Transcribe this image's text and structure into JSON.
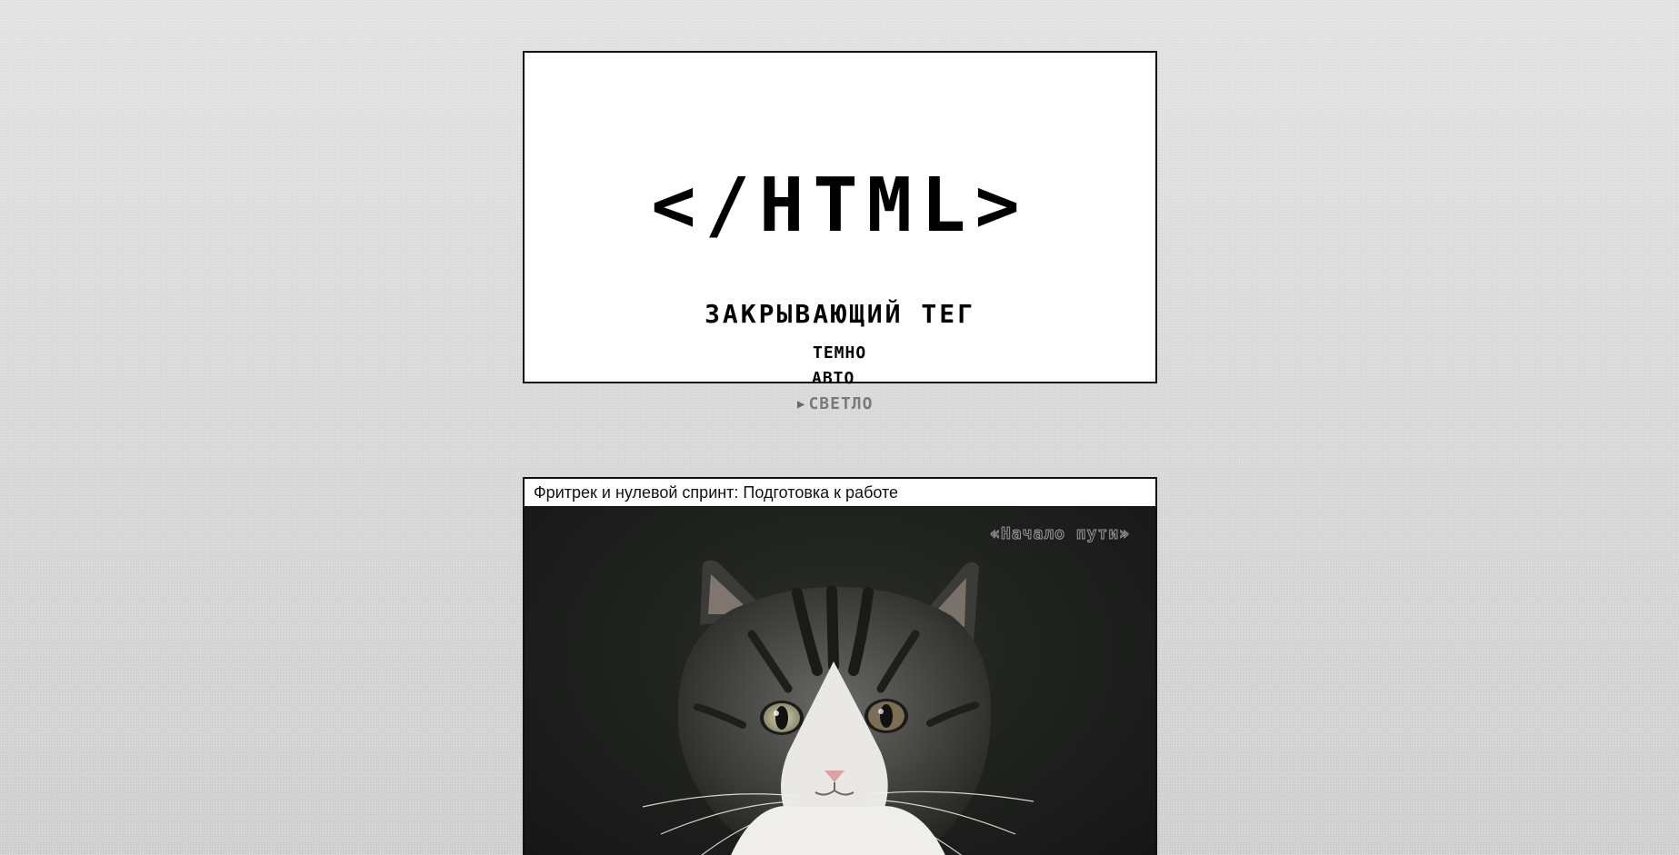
{
  "header": {
    "logo": "</HTML>",
    "subtitle": "ЗАКРЫВАЮЩИЙ ТЕГ",
    "theme_options": {
      "dark": "ТЕМНО",
      "auto": "АВТО",
      "light": "СВЕТЛО"
    },
    "selected_theme": "light",
    "selected_marker": "▶"
  },
  "post": {
    "title": "Фритрек и нулевой спринт: Подготовка к работе",
    "image_caption": "«Начало пути»",
    "image_subject": "tabby-and-white cat portrait"
  }
}
